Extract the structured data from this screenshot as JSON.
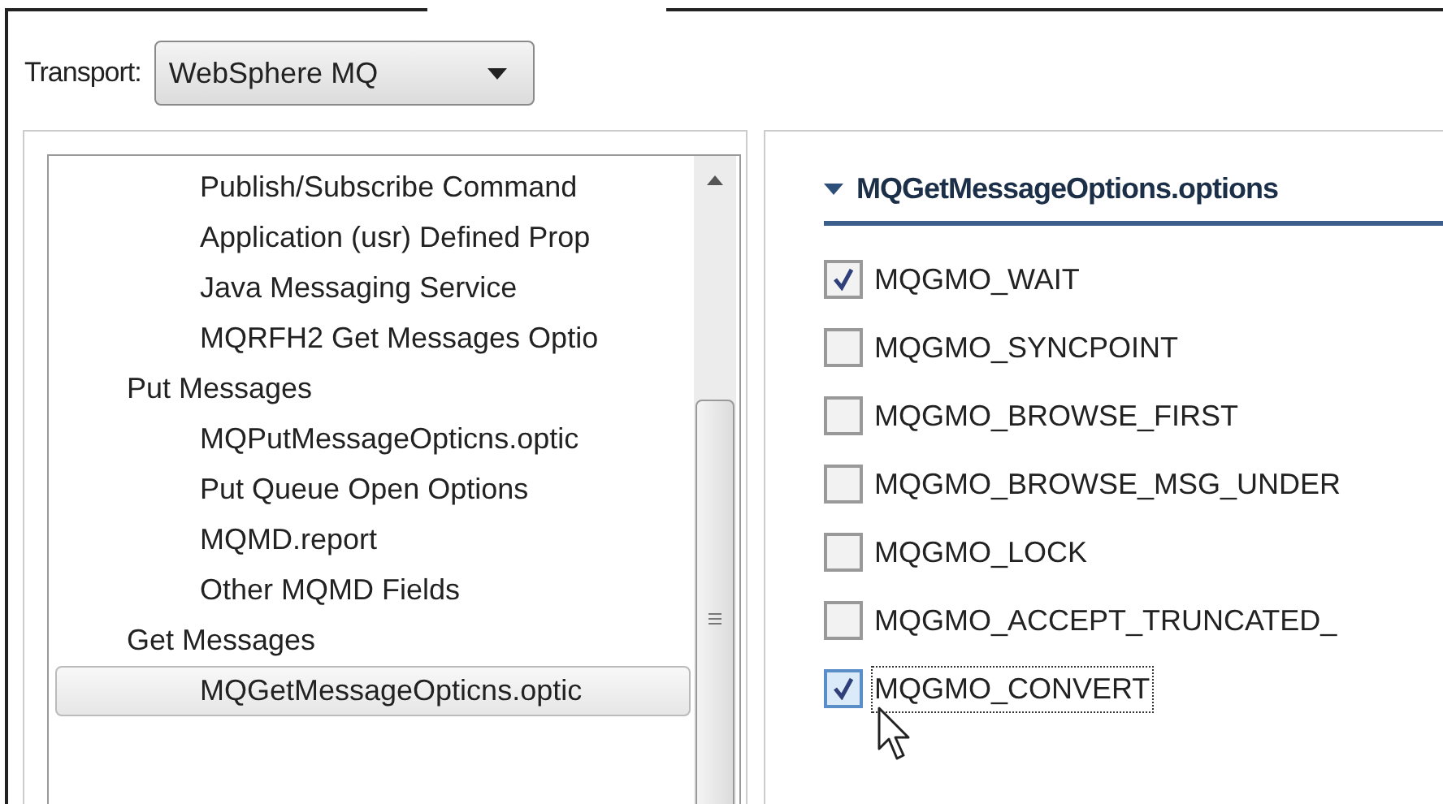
{
  "transport": {
    "label": "Transport:",
    "value": "WebSphere MQ"
  },
  "tree": {
    "orphan_children": [
      {
        "label": "Publish/Subscribe Command",
        "selected": false
      },
      {
        "label": "Application (usr) Defined Prop",
        "selected": false
      },
      {
        "label": "Java Messaging Service",
        "selected": false
      },
      {
        "label": "MQRFH2 Get Messages Optio",
        "selected": false
      }
    ],
    "items": [
      {
        "label": "Put Messages",
        "selected": false,
        "children": [
          {
            "label": "MQPutMessageOpticns.optic",
            "selected": false
          },
          {
            "label": "Put Queue Open Options",
            "selected": false
          },
          {
            "label": "MQMD.report",
            "selected": false
          },
          {
            "label": "Other MQMD Fields",
            "selected": false
          }
        ]
      },
      {
        "label": "Get Messages",
        "selected": false,
        "children": [
          {
            "label": "MQGetMessageOpticns.optic",
            "selected": true
          }
        ]
      }
    ]
  },
  "section": {
    "title": "MQGetMessageOptions.options",
    "expanded": true,
    "options": [
      {
        "label": "MQGMO_WAIT",
        "checked": true,
        "focused": false
      },
      {
        "label": "MQGMO_SYNCPOINT",
        "checked": false,
        "focused": false
      },
      {
        "label": "MQGMO_BROWSE_FIRST",
        "checked": false,
        "focused": false
      },
      {
        "label": "MQGMO_BROWSE_MSG_UNDER",
        "checked": false,
        "focused": false
      },
      {
        "label": "MQGMO_LOCK",
        "checked": false,
        "focused": false
      },
      {
        "label": "MQGMO_ACCEPT_TRUNCATED_",
        "checked": false,
        "focused": false
      },
      {
        "label": "MQGMO_CONVERT",
        "checked": true,
        "focused": true
      }
    ]
  }
}
